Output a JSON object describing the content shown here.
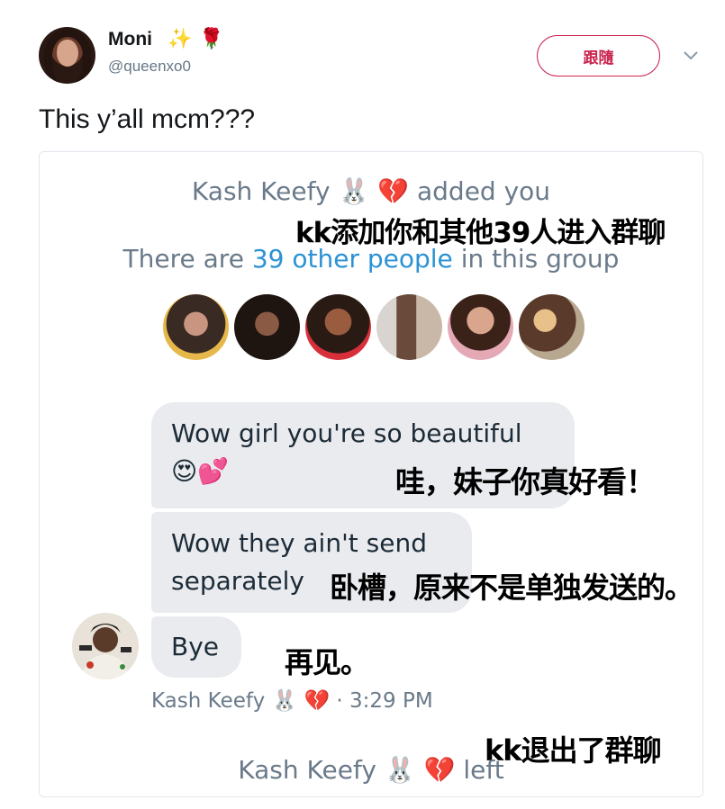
{
  "tweet": {
    "author_name": "Moni",
    "name_emojis": [
      "✨",
      "🌹"
    ],
    "handle": "@queenxo0",
    "follow_label": "跟隨",
    "text": "This y’all mcm???"
  },
  "screenshot": {
    "added_line": {
      "sender": "Kash Keefy",
      "emojis": "🐰 💔",
      "action": "added you"
    },
    "group_line": {
      "prefix": "There are",
      "link": "39 other people",
      "suffix": "in this group"
    },
    "messages": [
      {
        "line1": "Wow girl you're so beautiful",
        "line2": "😍💕"
      },
      {
        "line1": "Wow they ain't send",
        "line2": "separately"
      },
      {
        "line1": "Bye"
      }
    ],
    "meta": {
      "sender": "Kash Keefy",
      "emojis": "🐰 💔",
      "separator": "·",
      "time": "3:29 PM"
    },
    "left_line": {
      "sender": "Kash Keefy",
      "emojis": "🐰 💔",
      "action": "left"
    }
  },
  "captions": {
    "added": "kk添加你和其他39人进入群聊",
    "beautiful": "哇，妹子你真好看！",
    "separately": "卧槽，原来不是单独发送的。",
    "bye": "再见。",
    "left": "kk退出了群聊"
  },
  "colors": {
    "follow_accent": "#c9244e",
    "link_blue": "#2b92d5",
    "bubble_gray": "#e9ebef",
    "muted_text": "#6a7a8a"
  }
}
